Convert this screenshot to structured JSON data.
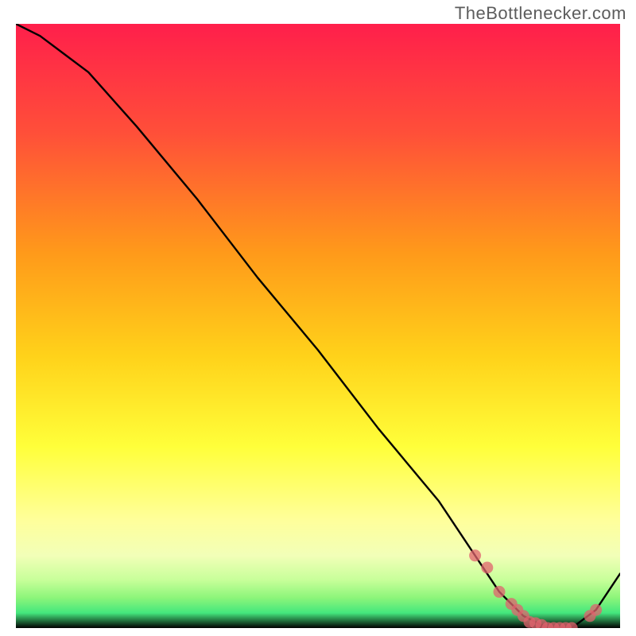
{
  "watermark": "TheBottlenecker.com",
  "colors": {
    "gradient_top": "#ff1f4b",
    "gradient_mid_upper": "#ff7a1a",
    "gradient_mid": "#ffe x000",
    "gradient_lower": "#ffff7a",
    "gradient_pale": "#f6ffb0",
    "gradient_green1": "#9bff6a",
    "gradient_green2": "#22e07a",
    "curve": "#000000",
    "marker_fill": "#e0636e",
    "marker_stroke": "#d94f5c"
  },
  "chart_data": {
    "type": "line",
    "title": "",
    "xlabel": "",
    "ylabel": "",
    "xlim": [
      0,
      100
    ],
    "ylim": [
      0,
      100
    ],
    "series": [
      {
        "name": "bottleneck-curve",
        "x": [
          0,
          4,
          8,
          12,
          20,
          30,
          40,
          50,
          60,
          70,
          76,
          80,
          84,
          88,
          90,
          92,
          96,
          100
        ],
        "y": [
          100,
          98,
          95,
          92,
          83,
          71,
          58,
          46,
          33,
          21,
          12,
          6,
          2,
          0,
          0,
          0,
          3,
          9
        ]
      }
    ],
    "markers": {
      "name": "highlight-dots",
      "x": [
        76,
        78,
        80,
        82,
        83,
        84,
        85,
        86,
        87,
        88,
        89,
        90,
        91,
        92,
        95,
        96
      ],
      "y": [
        12,
        10,
        6,
        4,
        3,
        2,
        1,
        0.8,
        0.5,
        0,
        0,
        0,
        0,
        0,
        2,
        3
      ]
    }
  }
}
